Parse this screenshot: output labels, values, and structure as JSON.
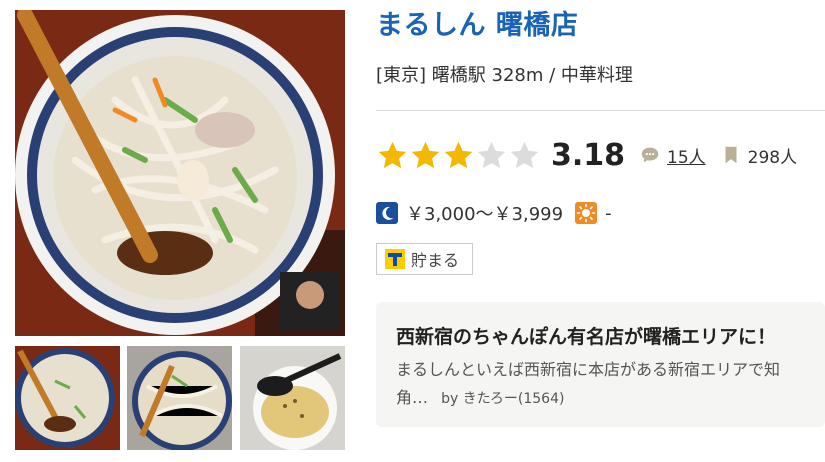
{
  "restaurant": {
    "name": "まるしん 曙橋店",
    "area": "[東京] 曙橋駅 328m / 中華料理"
  },
  "rating": {
    "score": "3.18",
    "stars": 3.18,
    "max_stars": 5,
    "review_count": "15人",
    "bookmark_count": "298人"
  },
  "budget": {
    "dinner": "￥3,000～￥3,999",
    "lunch": "-"
  },
  "tag": {
    "label": "貯まる"
  },
  "review": {
    "title": "西新宿のちゃんぽん有名店が曙橋エリアに！",
    "text_line1": "まるしんといえば西新宿に本店がある新宿エリアで知",
    "text_line2": "角…",
    "by": "by きたろー(1564)"
  },
  "colors": {
    "title": "#1a63b8",
    "star_on": "#f5b800",
    "star_off": "#dcdcdc",
    "moon_icon_bg": "#1a4f9c",
    "sun_icon_bg": "#f08a24",
    "tpoint_yellow": "#fecc00",
    "tpoint_blue": "#0a4aa8"
  },
  "icons": {
    "reviews": "speech-bubble-icon",
    "bookmarks": "bookmark-icon",
    "dinner": "moon-icon",
    "lunch": "sun-icon",
    "tag": "t-point-icon"
  }
}
